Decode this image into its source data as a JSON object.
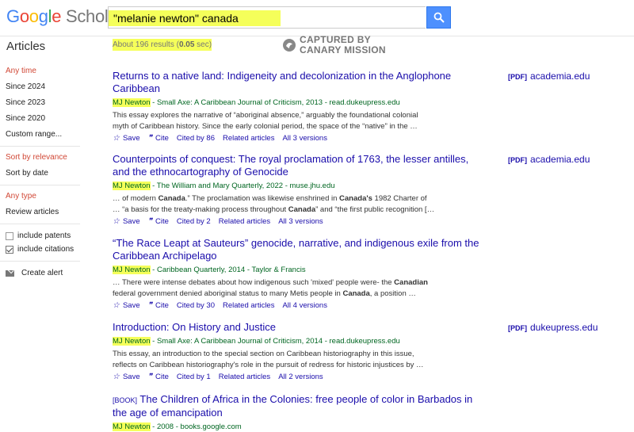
{
  "logo": {
    "google": "Google",
    "scholar": "Scholar"
  },
  "search": {
    "query": "\"melanie newton\" canada"
  },
  "header": {
    "articles": "Articles",
    "results_prefix": "About 196 results (",
    "results_time": "0.05",
    "results_suffix": " sec)"
  },
  "watermark": {
    "line1": "CAPTURED BY",
    "line2": "CANARY MISSION"
  },
  "sidebar": {
    "time": [
      "Any time",
      "Since 2024",
      "Since 2023",
      "Since 2020",
      "Custom range..."
    ],
    "sort": [
      "Sort by relevance",
      "Sort by date"
    ],
    "type": [
      "Any type",
      "Review articles"
    ],
    "patents": "include patents",
    "citations": "include citations",
    "alert": "Create alert"
  },
  "results": [
    {
      "title": "Returns to a native land: Indigeneity and decolonization in the Anglophone Caribbean",
      "author": "MJ Newton",
      "meta": " - Small Axe: A Caribbean Journal of Criticism, 2013 - read.dukeupress.edu",
      "snippet1": "This essay explores the narrative of “aboriginal absence,” arguably the foundational colonial",
      "snippet2": "myth of Caribbean history. Since the early colonial period, the space of the “native” in the …",
      "save": "Save",
      "cite": "Cite",
      "cited": "Cited by 86",
      "related": "Related articles",
      "versions": "All 3 versions",
      "pdf_tag": "[PDF]",
      "pdf_site": "academia.edu"
    },
    {
      "title": "Counterpoints of conquest: The royal proclamation of 1763, the lesser antilles, and the ethnocartography of Genocide",
      "author": "MJ Newton",
      "meta": " - The William and Mary Quarterly, 2022 - muse.jhu.edu",
      "snippet1": "… of modern Canada.” The proclamation was likewise enshrined in Canada's 1982 Charter of",
      "snippet2": "… “a basis for the treaty-making process throughout Canada” and “the first public recognition […",
      "save": "Save",
      "cite": "Cite",
      "cited": "Cited by 2",
      "related": "Related articles",
      "versions": "All 3 versions",
      "pdf_tag": "[PDF]",
      "pdf_site": "academia.edu"
    },
    {
      "title": "“The Race Leapt at Sauteurs” genocide, narrative, and indigenous exile from the Caribbean Archipelago",
      "author": "MJ Newton",
      "meta": " - Caribbean Quarterly, 2014 - Taylor & Francis",
      "snippet1": "… There were intense debates about how indigenous such 'mixed' people were- the Canadian",
      "snippet2": "federal government denied aboriginal status to many Metis people in Canada, a position …",
      "save": "Save",
      "cite": "Cite",
      "cited": "Cited by 30",
      "related": "Related articles",
      "versions": "All 4 versions"
    },
    {
      "title": "Introduction: On History and Justice",
      "author": "MJ Newton",
      "meta": " - Small Axe: A Caribbean Journal of Criticism, 2014 - read.dukeupress.edu",
      "snippet1": "This essay, an introduction to the special section on Caribbean historiography in this issue,",
      "snippet2": "reflects on Caribbean historiography's role in the pursuit of redress for historic injustices by …",
      "save": "Save",
      "cite": "Cite",
      "cited": "Cited by 1",
      "related": "Related articles",
      "versions": "All 2 versions",
      "pdf_tag": "[PDF]",
      "pdf_site": "dukeupress.edu"
    },
    {
      "book_tag": "[BOOK]",
      "title": "The Children of Africa in the Colonies: free people of color in Barbados in the age of emancipation",
      "author": "MJ Newton",
      "meta": " - 2008 - books.google.com"
    }
  ]
}
